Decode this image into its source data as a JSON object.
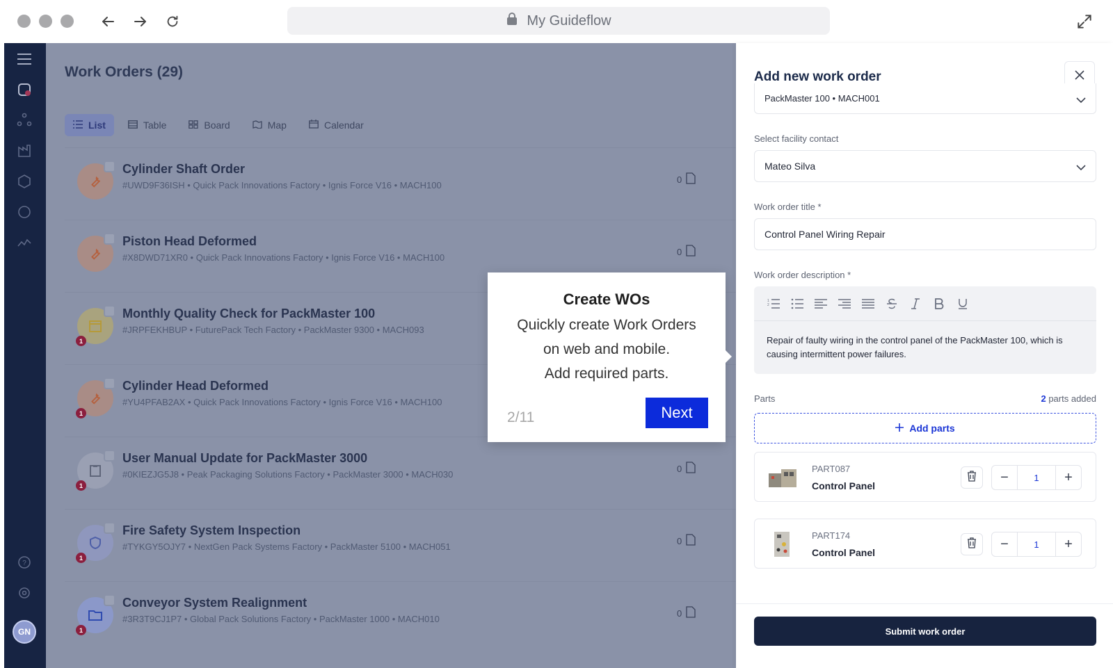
{
  "browser": {
    "url_title": "My Guideflow"
  },
  "sidebar": {
    "avatar_initials": "GN"
  },
  "workorders": {
    "title": "Work Orders (29)",
    "views": [
      {
        "label": "List",
        "icon": "list-icon"
      },
      {
        "label": "Table",
        "icon": "table-icon"
      },
      {
        "label": "Board",
        "icon": "board-icon"
      },
      {
        "label": "Map",
        "icon": "map-icon"
      },
      {
        "label": "Calendar",
        "icon": "calendar-icon"
      }
    ],
    "items": [
      {
        "title": "Cylinder Shaft Order",
        "meta": "#UWD9F36ISH  •  Quick Pack Innovations Factory  •  Ignis Force V16  •  MACH100",
        "count": "0",
        "icon": "wrench-icon",
        "badge": ""
      },
      {
        "title": "Piston Head Deformed",
        "meta": "#X8DWD71XR0  •  Quick Pack Innovations Factory  •  Ignis Force V16  •  MACH100",
        "count": "0",
        "icon": "wrench-icon",
        "badge": ""
      },
      {
        "title": "Monthly Quality Check for PackMaster 100",
        "meta": "#JRPFEKHBUP  •  FuturePack Tech Factory  •  PackMaster 9300  •  MACH093",
        "count": "",
        "icon": "calendar-check-icon",
        "badge": "1"
      },
      {
        "title": "Cylinder Head Deformed",
        "meta": "#YU4PFAB2AX  •  Quick Pack Innovations Factory  •  Ignis Force V16  •  MACH100",
        "count": "",
        "icon": "wrench-icon",
        "badge": "1"
      },
      {
        "title": "User Manual Update for PackMaster 3000",
        "meta": "#0KIEZJG5J8  •  Peak Packaging Solutions Factory  •  PackMaster 3000  •  MACH030",
        "count": "0",
        "icon": "clipboard-icon",
        "badge": "1"
      },
      {
        "title": "Fire Safety System Inspection",
        "meta": "#TYKGY5OJY7  •  NextGen Pack Systems Factory  •  PackMaster 5100  •  MACH051",
        "count": "0",
        "icon": "shield-check-icon",
        "badge": "1"
      },
      {
        "title": "Conveyor System Realignment",
        "meta": "#3R3T9CJ1P7  •  Global Pack Solutions Factory  •  PackMaster 1000  •  MACH010",
        "count": "0",
        "icon": "folder-icon",
        "badge": "1"
      }
    ]
  },
  "tooltip": {
    "title": "Create WOs",
    "body_line1": "Quickly create Work Orders",
    "body_line2": "on web and mobile.",
    "body_line3": "Add required parts.",
    "step": "2/11",
    "next_label": "Next"
  },
  "panel": {
    "title": "Add new work order",
    "machine_value": "PackMaster 100 • MACH001",
    "contact_label": "Select facility contact",
    "contact_value": "Mateo Silva",
    "title_label": "Work order title *",
    "title_value": "Control Panel Wiring Repair",
    "desc_label": "Work order description *",
    "desc_value": "Repair of faulty wiring in the control panel of the PackMaster 100, which is causing intermittent power failures.",
    "parts_label": "Parts",
    "parts_count": "2",
    "parts_count_suffix": " parts added",
    "add_parts_label": "Add parts",
    "parts": [
      {
        "code": "PART087",
        "name": "Control Panel",
        "qty": "1"
      },
      {
        "code": "PART174",
        "name": "Control Panel",
        "qty": "1"
      }
    ],
    "submit_label": "Submit work order"
  },
  "colors": {
    "accent": "#0C2BDB",
    "navy": "#17233F",
    "badge": "#8B1F3E"
  }
}
